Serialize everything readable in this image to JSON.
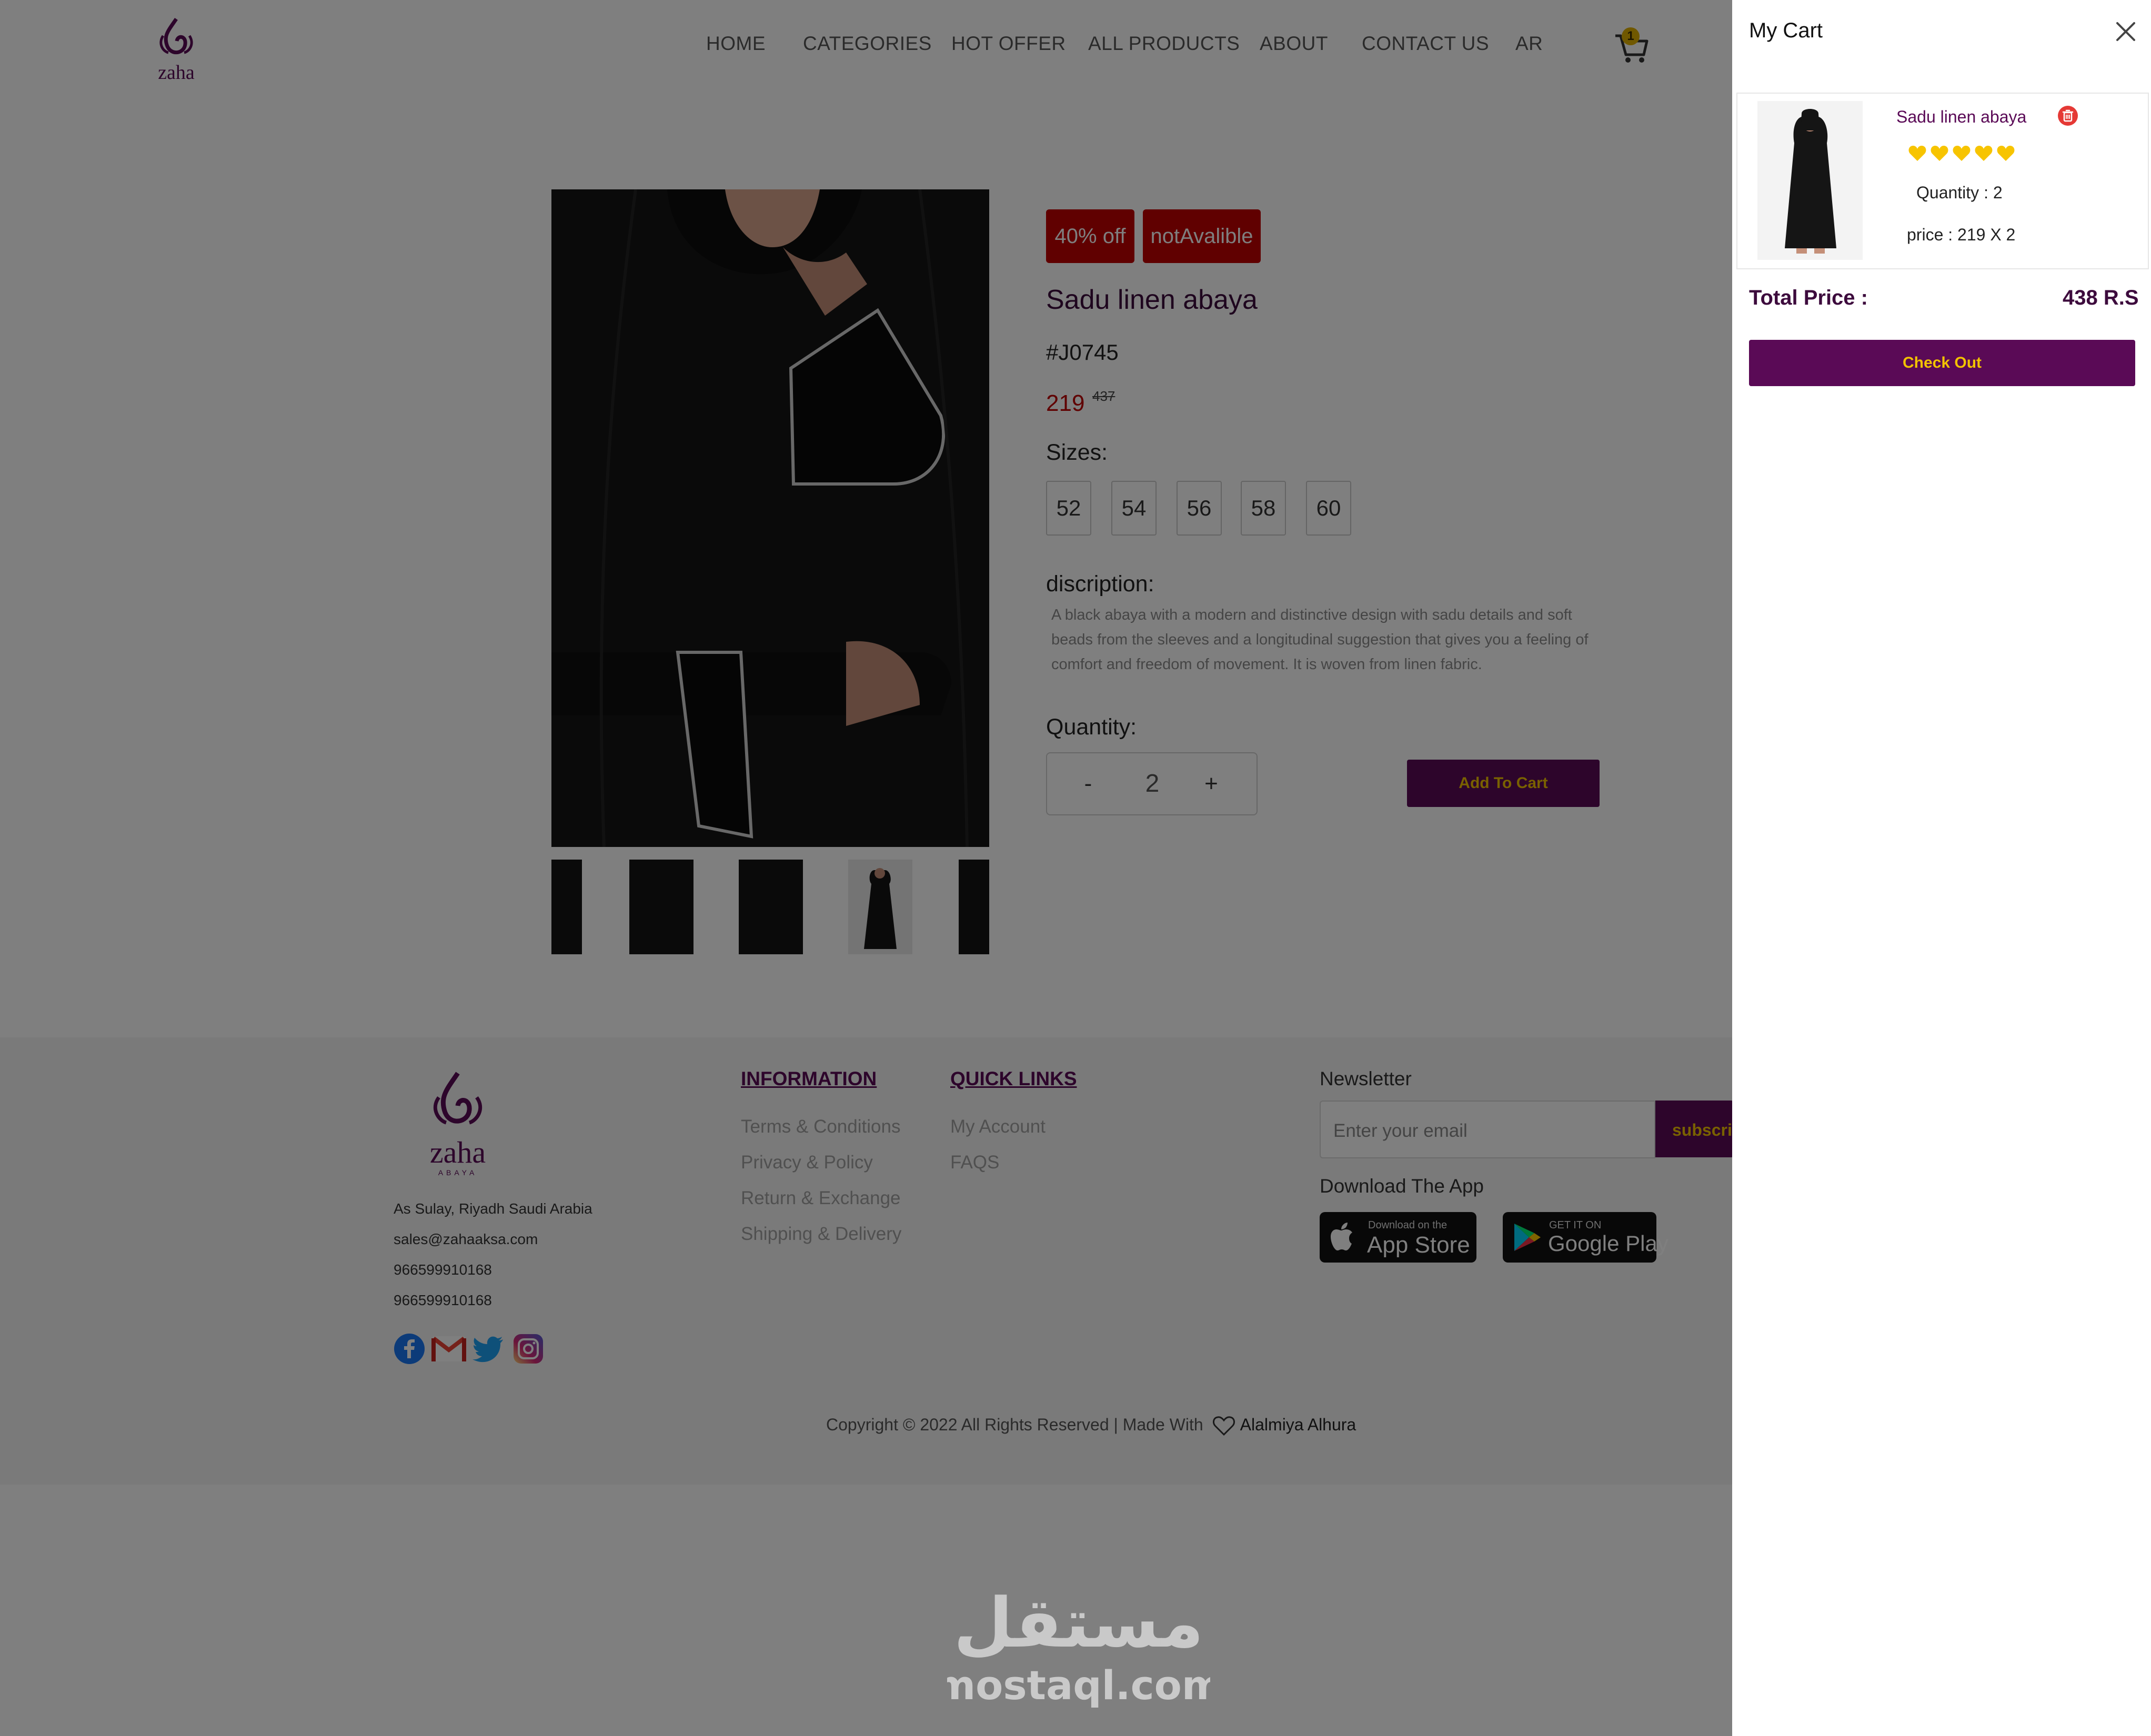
{
  "brand": {
    "logo_text": "zaha",
    "logo_sub": "ABAYA",
    "color": "#5a0a56"
  },
  "nav": {
    "items": [
      "HOME",
      "CATEGORIES",
      "HOT OFFER",
      "ALL PRODUCTS",
      "ABOUT",
      "CONTACT US",
      "AR"
    ],
    "cart_count": "1"
  },
  "product": {
    "discount_badge": "40% off",
    "availability_badge": "notAvalible",
    "title": "Sadu linen abaya",
    "sku": "#J0745",
    "price": "219",
    "old_price": "437",
    "sizes_label": "Sizes:",
    "sizes": [
      "52",
      "54",
      "56",
      "58",
      "60"
    ],
    "description_label": "discription:",
    "description": "A black abaya with a modern and distinctive design with sadu details and soft beads from the sleeves and a longitudinal suggestion that gives you a feeling of comfort and freedom of movement. It is woven from linen fabric.",
    "quantity_label": "Quantity:",
    "quantity": "2",
    "minus": "-",
    "plus": "+",
    "add_to_cart": "Add To Cart"
  },
  "footer": {
    "address": "As Sulay, Riyadh Saudi Arabia",
    "email": "sales@zahaaksa.com",
    "phone1": "966599910168",
    "phone2": "966599910168",
    "social_icons": [
      "facebook-icon",
      "gmail-icon",
      "twitter-icon",
      "instagram-icon"
    ],
    "information": {
      "title": "INFORMATION",
      "links": [
        "Terms & Conditions",
        "Privacy & Policy",
        "Return & Exchange",
        "Shipping & Delivery"
      ]
    },
    "quick_links": {
      "title": "QUICK LINKS",
      "links": [
        "My Account",
        "FAQS"
      ]
    },
    "newsletter": {
      "title": "Newsletter",
      "placeholder": "Enter your email",
      "button": "subscribe"
    },
    "download": {
      "title": "Download The App",
      "appstore_small": "Download on the",
      "appstore_big": "App Store",
      "play_small": "GET IT ON",
      "play_big": "Google Play"
    },
    "copyright": "Copyright © 2022 All Rights Reserved | Made With",
    "maker": "Alalmiya Alhura"
  },
  "watermark": {
    "arabic": "مستقل",
    "latin": "mostaql.com"
  },
  "cart": {
    "title": "My Cart",
    "item": {
      "name": "Sadu linen abaya",
      "rating": 5,
      "quantity_text": "Quantity : 2",
      "price_text": "price : 219 X 2"
    },
    "total_label": "Total Price :",
    "total_value": "438 R.S",
    "checkout": "Check Out"
  }
}
